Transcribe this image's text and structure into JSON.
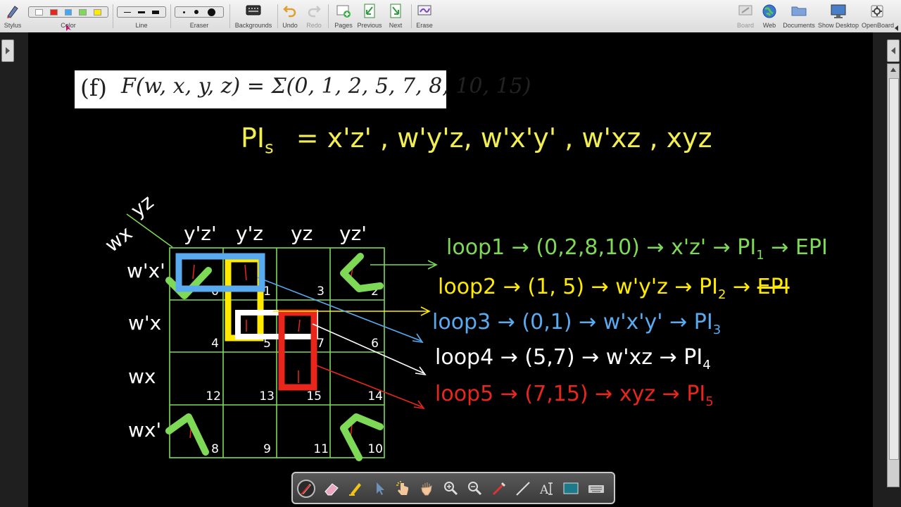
{
  "toolbar": {
    "stylus": "Stylus",
    "color": "Color",
    "line": "Line",
    "eraser": "Eraser",
    "backgrounds": "Backgrounds",
    "undo": "Undo",
    "redo": "Redo",
    "pages": "Pages",
    "previous": "Previous",
    "next": "Next",
    "erase": "Erase",
    "board": "Board",
    "web": "Web",
    "documents": "Documents",
    "show_desktop": "Show Desktop",
    "openboard": "OpenBoard",
    "palette_colors": [
      "#ffffff",
      "#e8261c",
      "#3ea8ff",
      "#7ed957",
      "#ffea00"
    ]
  },
  "problem": {
    "label": "(f)",
    "function": "F(w, x, y, z) = Σ(0, 1, 2, 5, 7, 8, 10, 15)"
  },
  "pis": {
    "text": "PI",
    "sub": "s",
    "list": "= x'z' , w'y'z, w'x'y' , w'xz , xyz"
  },
  "kmap": {
    "corner_rows": "wx",
    "corner_cols": "yz",
    "col_headers": [
      "y'z'",
      "y'z",
      "yz",
      "yz'"
    ],
    "row_headers": [
      "w'x'",
      "w'x",
      "wx",
      "wx'"
    ],
    "cells": [
      [
        "0",
        "1",
        "3",
        "2"
      ],
      [
        "4",
        "5",
        "7",
        "6"
      ],
      [
        "12",
        "13",
        "15",
        "14"
      ],
      [
        "8",
        "9",
        "11",
        "10"
      ]
    ]
  },
  "loops": [
    {
      "name": "loop1",
      "terms": "(0,2,8,10)",
      "expr": "x'z'",
      "pi": "PI",
      "pi_sub": "1",
      "extra": "EPI",
      "color": "#7ed957"
    },
    {
      "name": "loop2",
      "terms": "(1, 5)",
      "expr": "w'y'z",
      "pi": "PI",
      "pi_sub": "2",
      "extra": "EPI",
      "color": "#ffea00"
    },
    {
      "name": "loop3",
      "terms": "(0,1)",
      "expr": "w'x'y'",
      "pi": "PI",
      "pi_sub": "3",
      "extra": "",
      "color": "#5aaaf0"
    },
    {
      "name": "loop4",
      "terms": "(5,7)",
      "expr": "w'xz",
      "pi": "PI",
      "pi_sub": "4",
      "extra": "",
      "color": "#ffffff"
    },
    {
      "name": "loop5",
      "terms": "(7,15)",
      "expr": "xyz",
      "pi": "PI",
      "pi_sub": "5",
      "extra": "",
      "color": "#e8261c"
    }
  ]
}
